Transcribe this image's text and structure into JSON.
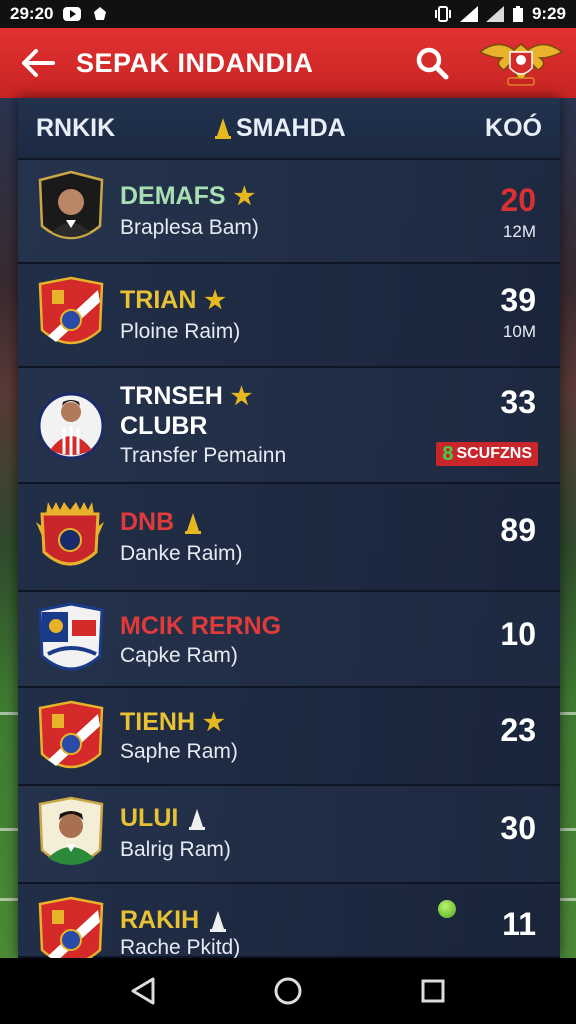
{
  "status_bar": {
    "time_left": "29:20",
    "time_right": "9:29",
    "icons": [
      "play-icon",
      "notification-icon",
      "vibrate-icon",
      "signal-icon",
      "battery-icon"
    ]
  },
  "app_bar": {
    "title": "SEPAK INDANDIA",
    "back_icon": "arrow-left-icon",
    "search_icon": "search-icon",
    "logo": "eagle-crest-logo"
  },
  "columns": {
    "left": "RNKIK",
    "middle": "SMAHDA",
    "right": "KOÓ"
  },
  "rows": [
    {
      "name": "DEMAFS",
      "name_color": "#a8e0b4",
      "marker": "star",
      "sub": "Braplesa Bam)",
      "score": "20",
      "score_color": "#d93034",
      "score_sub": "12M"
    },
    {
      "name": "TRIAN",
      "name_color": "#e8c233",
      "marker": "star",
      "sub": "Ploine Raim)",
      "score": "39",
      "score_color": "#ffffff",
      "score_sub": "10M"
    },
    {
      "name": "TRNSEH",
      "name2": "CLUBR",
      "name_color": "#ffffff",
      "marker": "star",
      "sub": "Transfer Pemainn",
      "score": "33",
      "score_color": "#ffffff",
      "tag_num": "8",
      "tag_text": "SCUFZNS"
    },
    {
      "name": "DNB",
      "name_color": "#e03a3a",
      "marker": "pawn",
      "sub": "Danke Raim)",
      "score": "89",
      "score_color": "#ffffff"
    },
    {
      "name": "MCIK RERNG",
      "name_color": "#e03a3a",
      "marker": "",
      "sub": "Capke Ram)",
      "score": "10",
      "score_color": "#ffffff"
    },
    {
      "name": "TIENH",
      "name_color": "#e8c233",
      "marker": "star",
      "sub": "Saphe Ram)",
      "score": "23",
      "score_color": "#ffffff"
    },
    {
      "name": "ULUI",
      "name_color": "#e8c233",
      "marker": "pawn-white",
      "sub": "Balrig Ram)",
      "score": "30",
      "score_color": "#ffffff"
    },
    {
      "name": "RAKIH",
      "name_color": "#e8c233",
      "marker": "pawn-white",
      "sub": "Rache Pkitd)",
      "score": "11",
      "score_color": "#ffffff",
      "dot": "green"
    }
  ],
  "nav_bar": {
    "back": "nav-back-icon",
    "home": "nav-home-icon",
    "recents": "nav-recents-icon"
  }
}
